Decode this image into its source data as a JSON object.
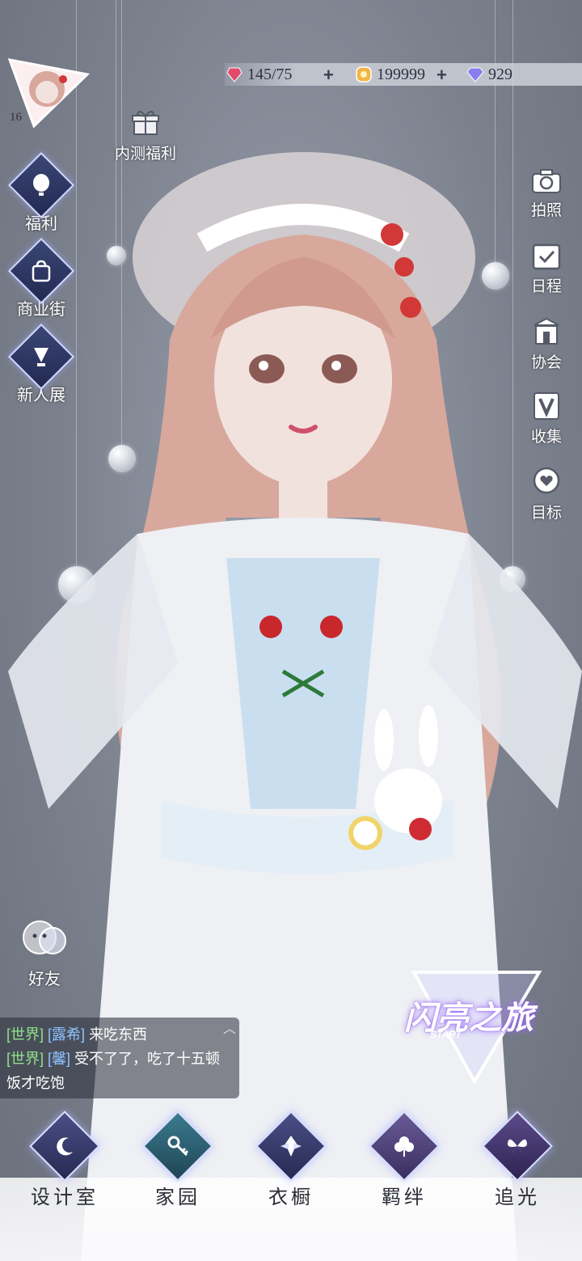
{
  "currency": {
    "stamina": "145/75",
    "gold": "199999",
    "diamonds": "929",
    "colors": {
      "stamina": "#e24a6a",
      "gold": "#f2b544",
      "diamond": "#8a7df0"
    }
  },
  "player": {
    "level": "16"
  },
  "top_event": {
    "label": "内测福利"
  },
  "left_menu": [
    {
      "label": "福利",
      "icon": "hot-air-balloon-icon"
    },
    {
      "label": "商业街",
      "icon": "shopping-bag-icon"
    },
    {
      "label": "新人展",
      "icon": "trophy-icon"
    }
  ],
  "right_menu": [
    {
      "label": "拍照",
      "icon": "camera-icon"
    },
    {
      "label": "日程",
      "icon": "calendar-check-icon"
    },
    {
      "label": "协会",
      "icon": "guild-hall-icon"
    },
    {
      "label": "收集",
      "icon": "collection-v-icon"
    },
    {
      "label": "目标",
      "icon": "target-heart-icon"
    }
  ],
  "friends": {
    "label": "好友"
  },
  "chat": {
    "lines": [
      {
        "channel": "[世界]",
        "name": "[露希]",
        "text": "来吃东西"
      },
      {
        "channel": "[世界]",
        "name": "[馨]",
        "text": "受不了了，吃了十五顿饭才吃饱"
      }
    ]
  },
  "event_banner": {
    "title": "闪亮之旅",
    "subtitle": "START"
  },
  "bottom_nav": [
    {
      "label": "设计室",
      "icon": "moon-pen-icon",
      "color": "#3a3f6e"
    },
    {
      "label": "家园",
      "icon": "key-icon",
      "color": "#2f6a7a"
    },
    {
      "label": "衣橱",
      "icon": "crystal-icon",
      "color": "#3a3f6e"
    },
    {
      "label": "羁绊",
      "icon": "clover-icon",
      "color": "#5a4a7a"
    },
    {
      "label": "追光",
      "icon": "butterfly-icon",
      "color": "#4a3a6e"
    }
  ]
}
